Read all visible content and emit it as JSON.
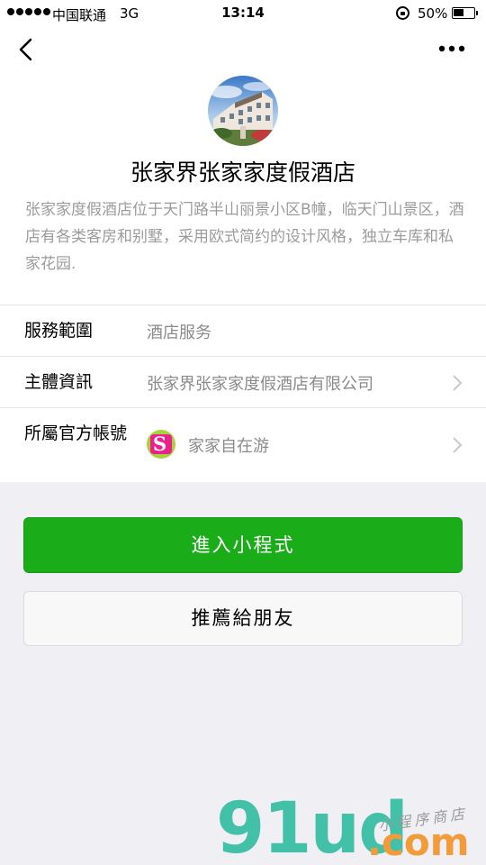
{
  "status_bar": {
    "carrier": "中国联通",
    "network": "3G",
    "time": "13:14",
    "battery": "50%",
    "battery_level": 0.5
  },
  "profile": {
    "title": "张家界张家家度假酒店",
    "description": "张家家度假酒店位于天门路半山丽景小区B幢，临天门山景区，酒店有各类客房和别墅，采用欧式简约的设计风格，独立车库和私家花园."
  },
  "info": [
    {
      "label": "服務範圍",
      "value": "酒店服务"
    },
    {
      "label": "主體資訊",
      "value": "张家界张家家度假酒店有限公司"
    },
    {
      "label": "所屬官方帳號",
      "value": "家家自在游",
      "account_icon_text": "S"
    }
  ],
  "buttons": {
    "enter": "進入小程式",
    "recommend": "推薦給朋友"
  },
  "watermark": {
    "main": "91ud",
    "sub": ".com",
    "tag": "小程序商店"
  },
  "colors": {
    "primary_green": "#1aad19",
    "watermark_teal": "#43c0a8",
    "watermark_orange": "#f29b38"
  }
}
